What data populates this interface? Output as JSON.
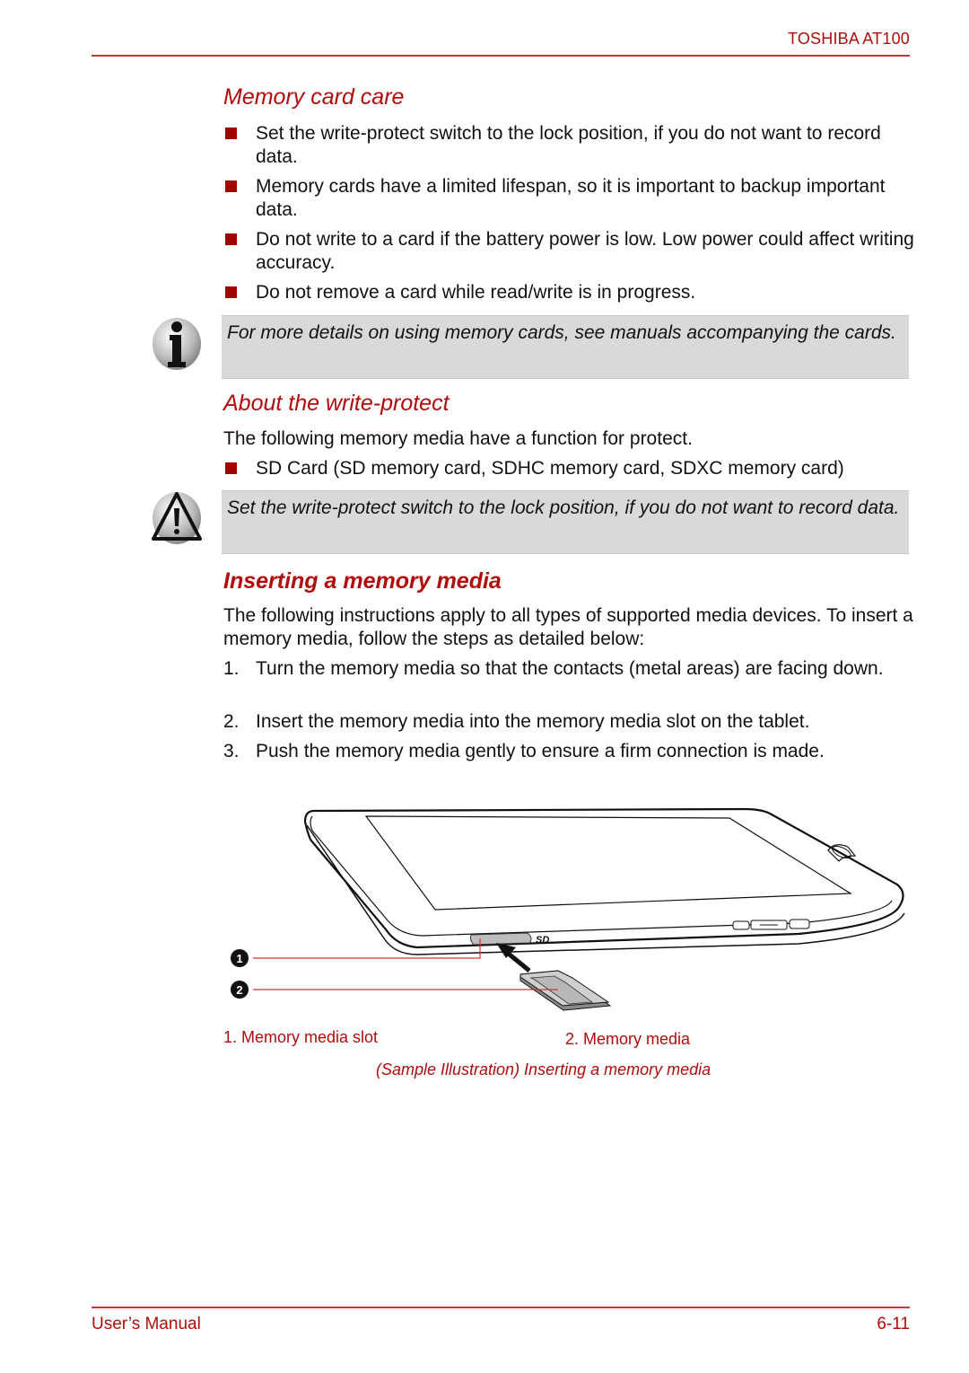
{
  "header": {
    "brand": "TOSHIBA AT100"
  },
  "sections": {
    "memory_card_care": {
      "title": "Memory card care",
      "bullets": [
        "Set the write-protect switch to the lock position, if you do not want to record data.",
        "Memory cards have a limited lifespan, so it is important to backup important data.",
        "Do not write to a card if the battery power is low. Low power could affect writing accuracy.",
        "Do not remove a card while read/write is in progress."
      ],
      "note": {
        "icon": "info-icon",
        "text": "For more details on using memory cards, see manuals accompanying the cards."
      }
    },
    "write_protect": {
      "title": "About the write-protect",
      "intro": "The following memory media have a function for protect.",
      "bullets": [
        "SD Card (SD memory card, SDHC memory card, SDXC memory card)"
      ],
      "warning": {
        "icon": "warning-icon",
        "text": "Set the write-protect switch to the lock position, if you do not want to record data."
      }
    },
    "inserting": {
      "title": "Inserting a memory media",
      "intro": "The following instructions apply to all types of supported media devices. To insert a memory media, follow the steps as detailed below:",
      "steps": [
        {
          "n": "1.",
          "text": "Turn the memory media so that the contacts (metal areas) are facing down."
        },
        {
          "n": "2.",
          "text": "Insert the memory media into the memory media slot on the tablet."
        },
        {
          "n": "3.",
          "text": "Push the memory media gently to ensure a firm connection is made."
        }
      ]
    }
  },
  "figure": {
    "callouts": [
      {
        "n": "1"
      },
      {
        "n": "2"
      }
    ],
    "sd_logo": "SD",
    "labels": [
      "1. Memory media slot",
      "2. Memory media"
    ],
    "caption": "(Sample Illustration) Inserting a memory media"
  },
  "footer": {
    "left": "User’s Manual",
    "right": "6-11"
  }
}
